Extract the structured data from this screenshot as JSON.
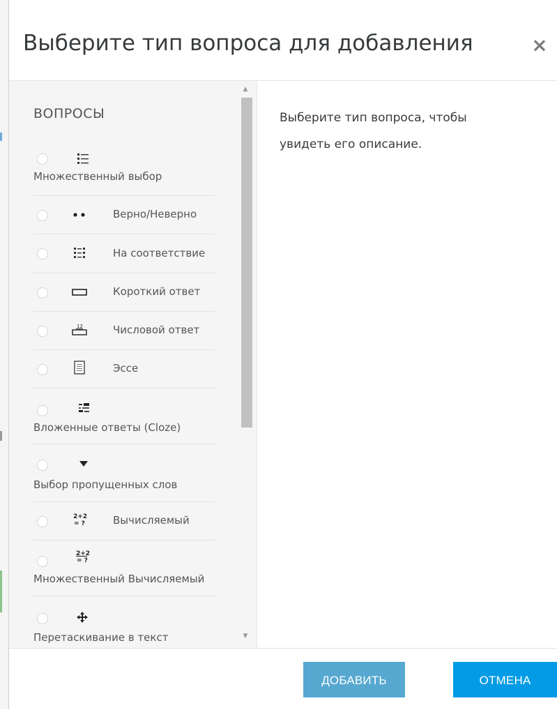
{
  "dialog": {
    "title": "Выберите тип вопроса для добавления",
    "close_symbol": "×"
  },
  "options_section": {
    "heading": "ВОПРОСЫ",
    "items": [
      {
        "label": "Множественный выбор",
        "icon": "multiple-choice-icon",
        "selected": false
      },
      {
        "label": "Верно/Неверно",
        "icon": "true-false-icon",
        "selected": false
      },
      {
        "label": "На соответствие",
        "icon": "matching-icon",
        "selected": false
      },
      {
        "label": "Короткий ответ",
        "icon": "short-answer-icon",
        "selected": false
      },
      {
        "label": "Числовой ответ",
        "icon": "numerical-icon",
        "selected": false
      },
      {
        "label": "Эссе",
        "icon": "essay-icon",
        "selected": false
      },
      {
        "label": "Вложенные ответы (Cloze)",
        "icon": "cloze-icon",
        "selected": false
      },
      {
        "label": "Выбор пропущенных слов",
        "icon": "dropdown-arrow-icon",
        "selected": false
      },
      {
        "label": "Вычисляемый",
        "icon": "calculated-icon",
        "selected": false
      },
      {
        "label": "Множественный Вычисляемый",
        "icon": "calculated-multichoice-icon",
        "selected": false
      },
      {
        "label": "Перетаскивание в текст",
        "icon": "drag-drop-icon",
        "selected": false
      }
    ]
  },
  "description": {
    "text": "Выберите тип вопроса, чтобы увидеть его описание."
  },
  "footer": {
    "add_label": "ДОБАВИТЬ",
    "cancel_label": "ОТМЕНА"
  },
  "colors": {
    "add_button": "#56a8d0",
    "cancel_button": "#039be5",
    "options_background": "#f5f5f5"
  }
}
